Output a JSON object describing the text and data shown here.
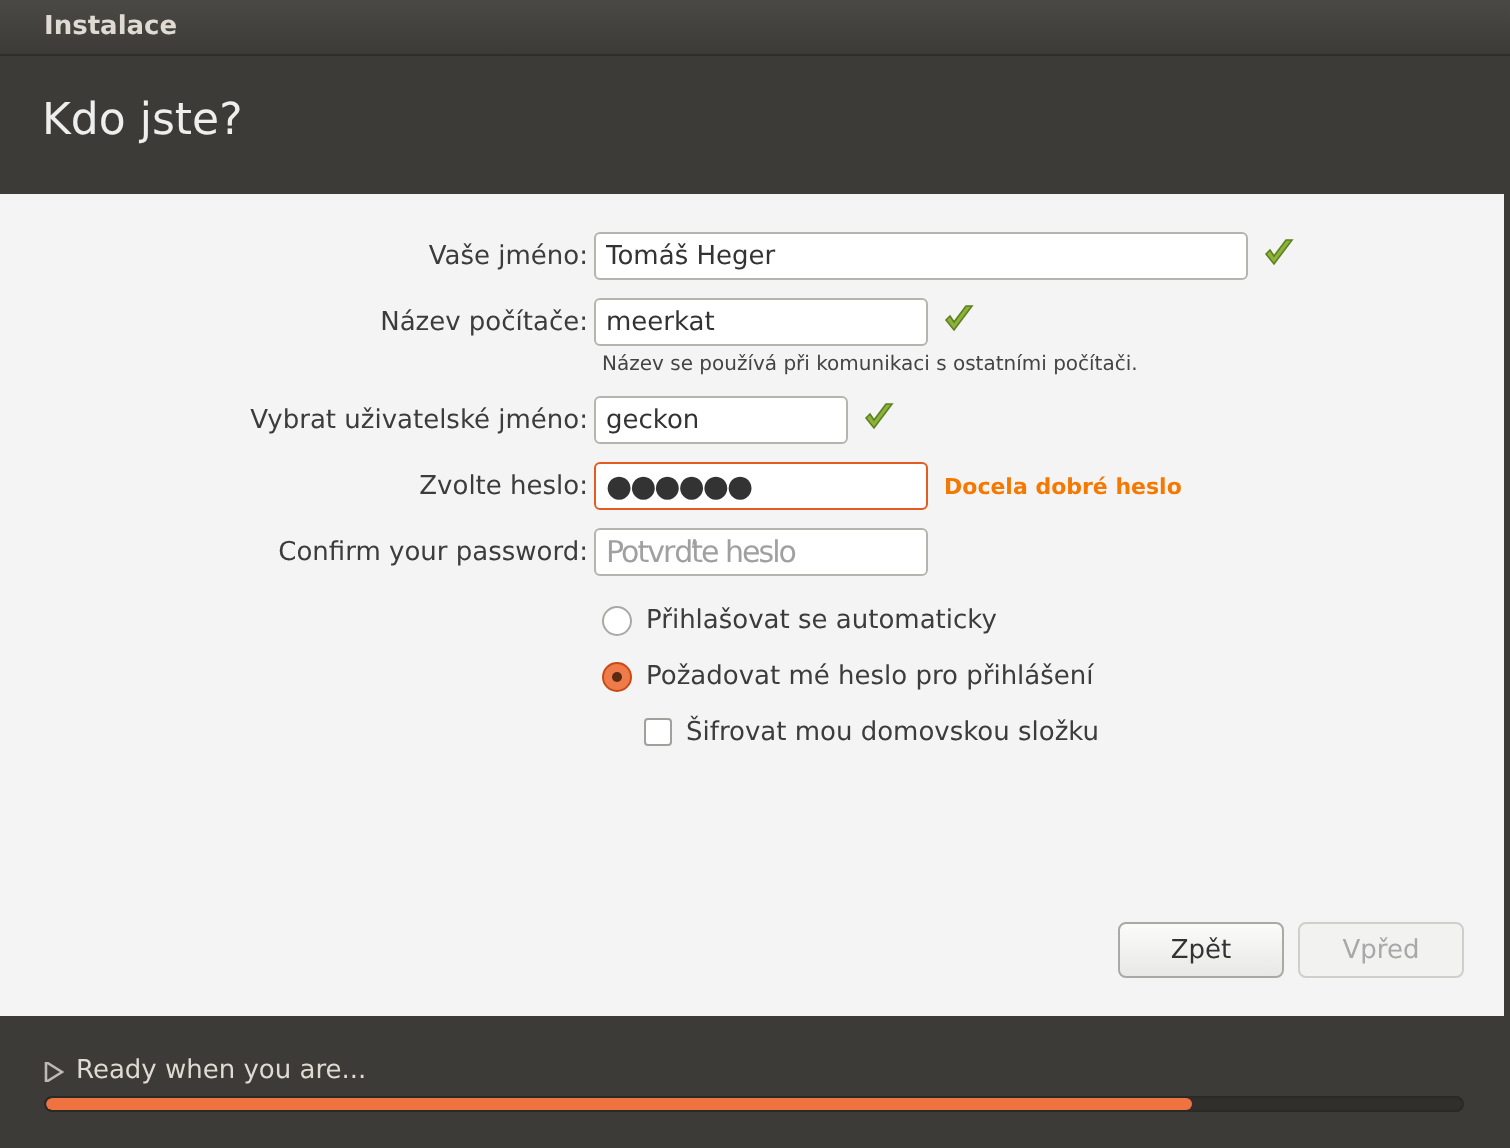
{
  "window": {
    "title": "Instalace"
  },
  "header": {
    "title": "Kdo jste?"
  },
  "fields": [
    {
      "kind": "text",
      "label": "Vaše jméno:",
      "value": "Tomáš Heger",
      "valid": true,
      "focused": false
    },
    {
      "kind": "text",
      "label": "Název počítače:",
      "value": "meerkat",
      "valid": true,
      "focused": false,
      "hint": "Název se používá při komunikaci s ostatními počítači."
    },
    {
      "kind": "text",
      "label": "Vybrat uživatelské jméno:",
      "value": "geckon",
      "valid": true,
      "focused": false
    },
    {
      "kind": "password",
      "label": "Zvolte heslo:",
      "value": "●●●●●●",
      "valid": false,
      "focused": true,
      "strength": "Docela dobré heslo"
    },
    {
      "kind": "password",
      "label": "Confirm your password:",
      "placeholder": "Potvrďte heslo",
      "valid": false,
      "focused": false
    }
  ],
  "login_options": [
    {
      "label": "Přihlašovat se automaticky",
      "selected": false
    },
    {
      "label": "Požadovat mé heslo pro přihlášení",
      "selected": true
    }
  ],
  "encrypt": {
    "label": "Šifrovat mou domovskou složku",
    "checked": false
  },
  "buttons": [
    {
      "label": "Zpět",
      "disabled": false
    },
    {
      "label": "Vpřed",
      "disabled": true
    }
  ],
  "footer": {
    "status": "Ready when you are...",
    "level": 0.81
  }
}
